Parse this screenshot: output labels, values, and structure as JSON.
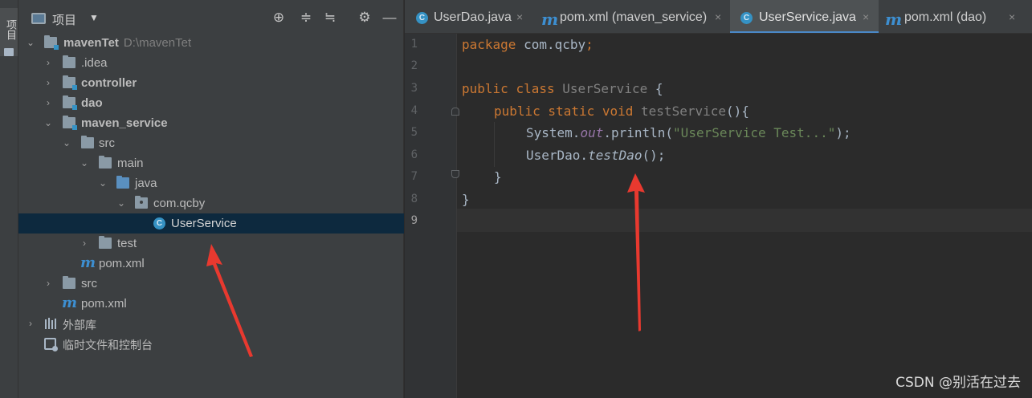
{
  "sidebar_strip": {
    "label": "项目"
  },
  "project_panel": {
    "title": "项目",
    "toolbar": [
      "locate-icon",
      "expand-all-icon",
      "collapse-all-icon",
      "gear-icon",
      "hide-icon"
    ],
    "tree": [
      {
        "label": "mavenTet",
        "path": "D:\\mavenTet",
        "bold": true,
        "expanded": true,
        "icon": "module-folder"
      },
      {
        "label": ".idea",
        "bold": false,
        "expanded": false,
        "icon": "folder"
      },
      {
        "label": "controller",
        "bold": true,
        "expanded": false,
        "icon": "module-folder"
      },
      {
        "label": "dao",
        "bold": true,
        "expanded": false,
        "icon": "module-folder"
      },
      {
        "label": "maven_service",
        "bold": true,
        "expanded": true,
        "icon": "module-folder"
      },
      {
        "label": "src",
        "bold": false,
        "expanded": true,
        "icon": "folder"
      },
      {
        "label": "main",
        "bold": false,
        "expanded": true,
        "icon": "folder"
      },
      {
        "label": "java",
        "bold": false,
        "expanded": true,
        "icon": "source-folder"
      },
      {
        "label": "com.qcby",
        "bold": false,
        "expanded": true,
        "icon": "package"
      },
      {
        "label": "UserService",
        "bold": false,
        "selected": true,
        "icon": "class"
      },
      {
        "label": "test",
        "bold": false,
        "expanded": false,
        "icon": "folder"
      },
      {
        "label": "pom.xml",
        "bold": false,
        "icon": "maven"
      },
      {
        "label": "src",
        "bold": false,
        "expanded": false,
        "icon": "folder"
      },
      {
        "label": "pom.xml",
        "bold": false,
        "icon": "maven"
      },
      {
        "label": "外部库",
        "bold": false,
        "expanded": false,
        "icon": "library"
      },
      {
        "label": "临时文件和控制台",
        "bold": false,
        "icon": "scratch"
      }
    ]
  },
  "editor": {
    "tabs": [
      {
        "label": "UserDao.java",
        "icon": "class",
        "active": false,
        "close": "×"
      },
      {
        "label": "pom.xml (maven_service)",
        "icon": "maven",
        "active": false,
        "close": "×"
      },
      {
        "label": "UserService.java",
        "icon": "class",
        "active": true,
        "close": "×"
      },
      {
        "label": "pom.xml (dao)",
        "icon": "maven",
        "active": false,
        "close": "×"
      }
    ],
    "line_numbers": [
      "1",
      "2",
      "3",
      "4",
      "5",
      "6",
      "7",
      "8",
      "9"
    ],
    "current_line": 9,
    "code": {
      "l1_kw": "package",
      "l1_rest": " com.qcby",
      "l1_semi": ";",
      "l3_kw1": "public",
      "l3_kw2": "class",
      "l3_name": "UserService",
      "l3_brace": "{",
      "l4_kw": "public static void",
      "l4_fn": "testService",
      "l4_rest": "(){",
      "l5_a": "System.",
      "l5_field": "out",
      "l5_b": ".println(",
      "l5_str": "\"UserService Test...\"",
      "l5_c": ");",
      "l6_a": "UserDao.",
      "l6_m": "testDao",
      "l6_b": "();",
      "l7": "}",
      "l8": "}"
    }
  },
  "watermark": "CSDN @别活在过去"
}
